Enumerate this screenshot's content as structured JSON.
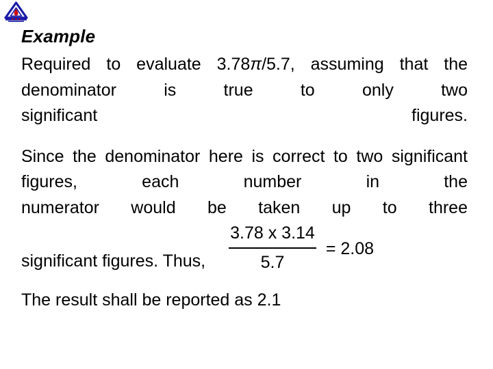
{
  "slide": {
    "background_color": "#ffffff",
    "text_color": "#000000",
    "logo": {
      "icon_name": "triangle-emblem-logo",
      "outline_color": "#1a1aa8",
      "accent_color": "#cc0000",
      "base_color": "#1a1aa8"
    },
    "heading": "Example",
    "paragraph1": {
      "line1_pre": "Required  to  evaluate  3.78",
      "pi": "π",
      "line1_post": "/5.7,  assuming",
      "line2": "that  the  denominator  is  true  to  only  two",
      "line3": "significant figures."
    },
    "paragraph2": {
      "line1": "Since the denominator here is correct to two",
      "line2": "significant  figures,  each  number  in  the",
      "line3": "numerator  would  be  taken  up  to  three"
    },
    "equation_line": {
      "lead_text": "significant figures. Thus,",
      "numerator": "3.78 x 3.14",
      "denominator": "5.7",
      "result": "= 2.08"
    },
    "conclusion": "The result shall be reported as 2.1"
  }
}
